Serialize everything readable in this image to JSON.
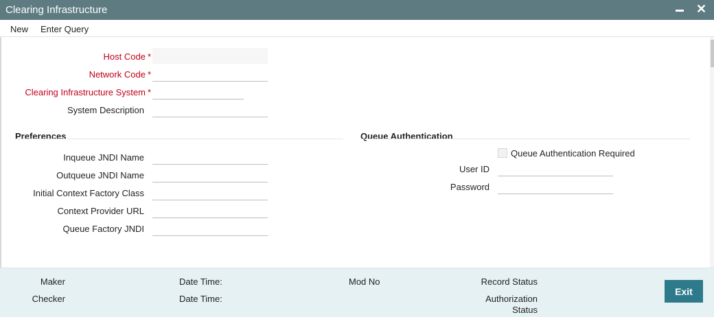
{
  "window": {
    "title": "Clearing Infrastructure"
  },
  "menu": {
    "new_label": "New",
    "enter_query_label": "Enter Query"
  },
  "main": {
    "host_code_label": "Host Code",
    "network_code_label": "Network Code",
    "clearing_system_label": "Clearing Infrastructure System",
    "system_description_label": "System Description",
    "required_mark": "*",
    "host_code_value": "",
    "network_code_value": "",
    "clearing_system_value": "",
    "system_description_value": ""
  },
  "preferences": {
    "title": "Preferences",
    "inqueue_label": "Inqueue JNDI Name",
    "outqueue_label": "Outqueue JNDI Name",
    "initial_context_label": "Initial Context Factory Class",
    "context_provider_label": "Context Provider URL",
    "queue_factory_label": "Queue Factory JNDI"
  },
  "queue_auth": {
    "title": "Queue Authentication",
    "required_label": "Queue Authentication Required",
    "required_checked": false,
    "user_id_label": "User ID",
    "password_label": "Password"
  },
  "footer": {
    "maker_label": "Maker",
    "checker_label": "Checker",
    "date_time_label": "Date Time:",
    "mod_no_label": "Mod No",
    "record_status_label": "Record Status",
    "authorization_status_line1": "Authorization",
    "authorization_status_line2": "Status",
    "exit_label": "Exit"
  },
  "colors": {
    "titlebar": "#5e7b82",
    "required_label": "#c0001a",
    "footer_bg": "#e5f1f2",
    "exit_button": "#2d7a8a"
  }
}
